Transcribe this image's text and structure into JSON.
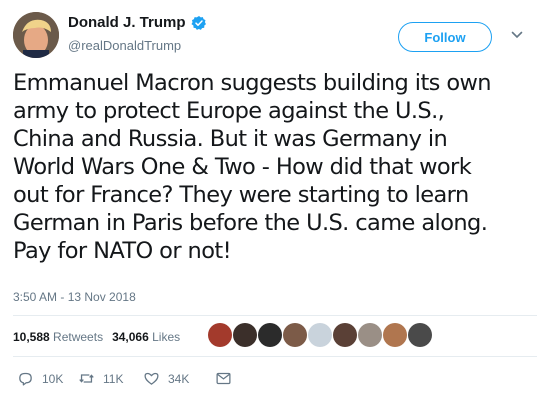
{
  "author": {
    "display_name": "Donald J. Trump",
    "handle": "@realDonaldTrump",
    "verified": true
  },
  "follow_label": "Follow",
  "tweet": {
    "lines": [
      "Emmanuel Macron suggests building its own",
      "army to protect Europe against the U.S.,",
      "China and Russia. But it was Germany in",
      "World Wars One & Two - How did that work",
      "out for France? They were starting to learn",
      "German in Paris before the U.S. came along.",
      "Pay for NATO or not!"
    ],
    "timestamp": "3:50 AM - 13 Nov 2018"
  },
  "stats": {
    "retweets_count": "10,588",
    "retweets_label": "Retweets",
    "likes_count": "34,066",
    "likes_label": "Likes"
  },
  "actions": {
    "reply_count": "10K",
    "retweet_count": "11K",
    "like_count": "34K"
  },
  "colors": {
    "accent": "#1da1f2",
    "secondary_text": "#657786",
    "divider": "#e6ecf0"
  },
  "icons": [
    "verified-badge-icon",
    "chevron-down-icon",
    "reply-icon",
    "retweet-icon",
    "heart-icon",
    "direct-message-icon"
  ]
}
